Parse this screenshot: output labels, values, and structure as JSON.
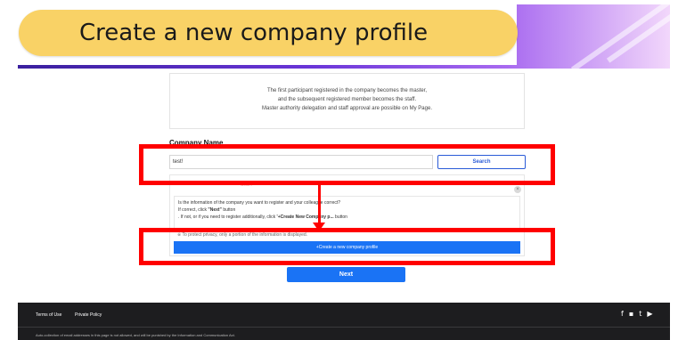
{
  "banner": {
    "title": "Create a new company profile"
  },
  "info": {
    "line1": "The first participant registered in the company becomes the master,",
    "line2": "and the subsequent registered member becomes the staff.",
    "line3": "Master authority delegation and staff approval are possible on My Page."
  },
  "form": {
    "company_name_label": "Company Name",
    "company_name_value": "test!",
    "search_label": "Search"
  },
  "result": {
    "hidden_note": "Sea...",
    "question": "Is the information of the company you want to register and your colleague correct?",
    "if_correct_prefix": "If correct, click ",
    "if_correct_button": "\"Next\"",
    "if_correct_suffix": " button",
    "if_not_prefix": ". If not, or if you need to register additionally, click ",
    "if_not_button": "'+Create New Company p...",
    "if_not_suffix": " button",
    "privacy_note": "※ To protect privacy, only a portion of the information is displayed.",
    "create_button_label": "+Create a new company profile",
    "close_symbol": "×"
  },
  "next_button_label": "Next",
  "footer": {
    "terms_label": "Terms of Use",
    "privacy_label": "Private Policy",
    "notice": "Auto-collection of email addresses in this page is not allowed, and will be punished by the Information and Communication Act.",
    "social_icons": [
      "facebook-icon",
      "chat-icon",
      "tumblr-icon",
      "youtube-icon"
    ]
  },
  "colors": {
    "highlight": "#ff0000",
    "primary_button": "#1a73f5",
    "title_pill": "#f9d266",
    "footer_bg": "#1d1d1f"
  }
}
